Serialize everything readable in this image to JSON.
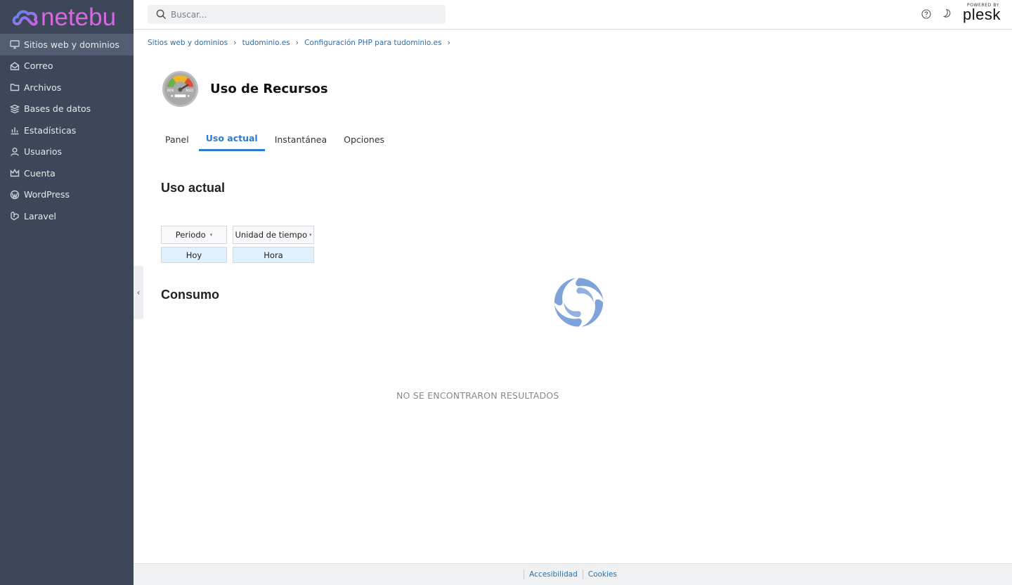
{
  "brand": {
    "name": "netebu"
  },
  "header": {
    "search_placeholder": "Buscar...",
    "plesk_small": "POWERED BY",
    "plesk_big": "plesk"
  },
  "sidebar": {
    "items": [
      {
        "label": "Sitios web y dominios",
        "icon": "monitor-icon"
      },
      {
        "label": "Correo",
        "icon": "mail-icon"
      },
      {
        "label": "Archivos",
        "icon": "folder-icon"
      },
      {
        "label": "Bases de datos",
        "icon": "database-icon"
      },
      {
        "label": "Estadísticas",
        "icon": "bar-chart-icon"
      },
      {
        "label": "Usuarios",
        "icon": "user-icon"
      },
      {
        "label": "Cuenta",
        "icon": "crown-icon"
      },
      {
        "label": "WordPress",
        "icon": "wordpress-icon"
      },
      {
        "label": "Laravel",
        "icon": "laravel-icon"
      }
    ],
    "active_index": 0
  },
  "breadcrumb": [
    "Sitios web y dominios",
    "tudominio.es",
    "Configuración PHP para tudominio.es"
  ],
  "page": {
    "title": "Uso de Recursos",
    "tabs": [
      "Panel",
      "Uso actual",
      "Instantánea",
      "Opciones"
    ],
    "active_tab": 1,
    "section1": "Uso actual",
    "section2": "Consumo",
    "filters": {
      "period_label": "Periodo",
      "period_value": "Hoy",
      "unit_label": "Unidad de tiempo",
      "unit_value": "Hora"
    },
    "no_results": "NO SE ENCONTRARON RESULTADOS"
  },
  "footer": {
    "links": [
      "Accesibilidad",
      "Cookies"
    ]
  },
  "colors": {
    "sidebar": "#3d4759",
    "accent": "#2b7bd1",
    "brand": "#d966e3"
  }
}
